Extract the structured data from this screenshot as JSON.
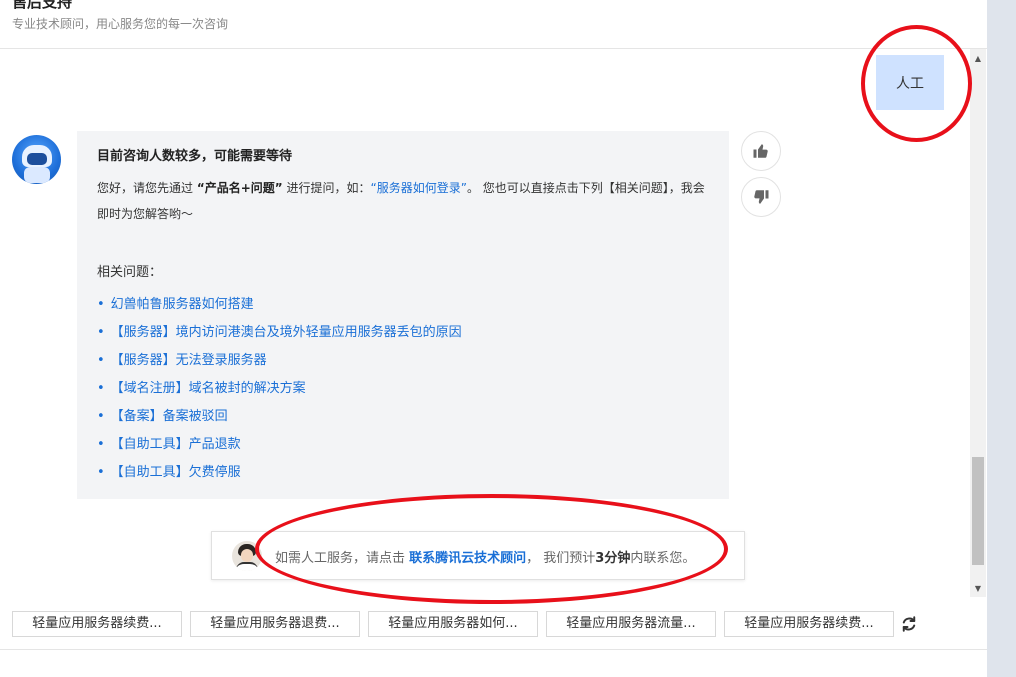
{
  "header": {
    "title": "售后支持",
    "subtitle": "专业技术顾问，用心服务您的每一次咨询"
  },
  "user_message": "人工",
  "bot_message": {
    "title": "目前咨询人数较多，可能需要等待",
    "text_1": "您好，请您先通过 ",
    "text_bold": "“产品名+问题”",
    "text_2": " 进行提问，如：",
    "text_link": "“服务器如何登录”",
    "text_3": "。 您也可以直接点击下列【相关问题】，我会即时为您解答哟～",
    "related_label": "相关问题：",
    "related": [
      "幻兽帕鲁服务器如何搭建",
      "【服务器】境内访问港澳台及境外轻量应用服务器丢包的原因",
      "【服务器】无法登录服务器",
      "【域名注册】域名被封的解决方案",
      "【备案】备案被驳回",
      "【自助工具】产品退款",
      "【自助工具】欠费停服"
    ]
  },
  "notice": {
    "text_1": "如需人工服务，请点击 ",
    "link": "联系腾讯云技术顾问",
    "text_2": "， 我们预计",
    "bold": "3分钟",
    "text_3": "内联系您。"
  },
  "suggestions": [
    "轻量应用服务器续费...",
    "轻量应用服务器退费...",
    "轻量应用服务器如何...",
    "轻量应用服务器流量...",
    "轻量应用服务器续费..."
  ],
  "colors": {
    "link": "#1a6fd6",
    "user_bubble": "#cfe2ff",
    "bot_bubble": "#f3f4f6",
    "annotation": "#e8101a"
  },
  "icons": {
    "thumbs_up": "thumbs-up-icon",
    "thumbs_down": "thumbs-down-icon",
    "refresh": "refresh-icon"
  }
}
